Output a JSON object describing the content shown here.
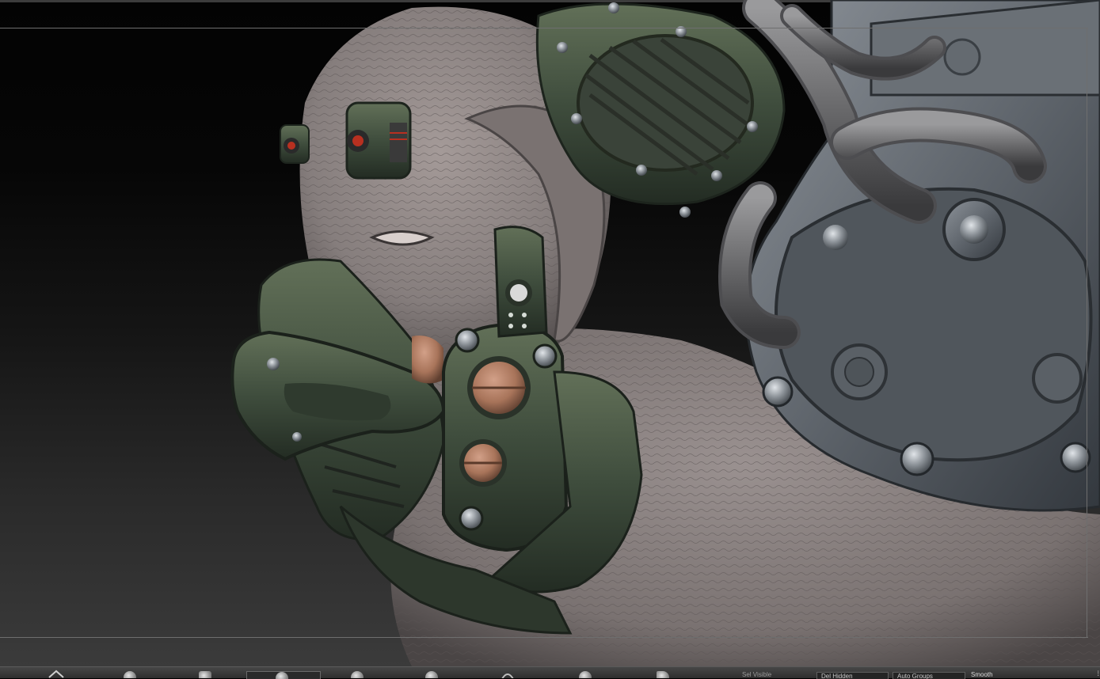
{
  "app": "ZBrush",
  "viewport": {
    "model_description": "Sculpted creature head with a mechanical breathing mask, goggle plate, cables and helmet plating"
  },
  "colors": {
    "skin": "#8a8280",
    "skin_dark": "#5e5858",
    "metal_green": "#3c4a3a",
    "metal_green_light": "#55634f",
    "helmet_steel": "#5b6168",
    "helmet_light": "#7d838a",
    "copper": "#b07c62",
    "eye_red": "#b83020",
    "frame_line": "#6e6e6e",
    "shelf_bg": "#3a3a3a"
  },
  "bottom_shelf": {
    "brushes": [
      {
        "icon": "transpose-brush-icon"
      },
      {
        "icon": "standard-brush-icon"
      },
      {
        "icon": "clay-brush-icon"
      },
      {
        "icon": "move-brush-icon"
      },
      {
        "icon": "dam-standard-brush-icon"
      },
      {
        "icon": "inflate-brush-icon"
      },
      {
        "icon": "pinch-brush-icon"
      },
      {
        "icon": "smooth-brush-icon"
      },
      {
        "icon": "trim-brush-icon"
      }
    ],
    "labels": {
      "sel_visible": "Sel Visible",
      "del_hidden": "Del Hidden",
      "auto_groups": "Auto Groups",
      "smooth": "Smooth"
    }
  }
}
